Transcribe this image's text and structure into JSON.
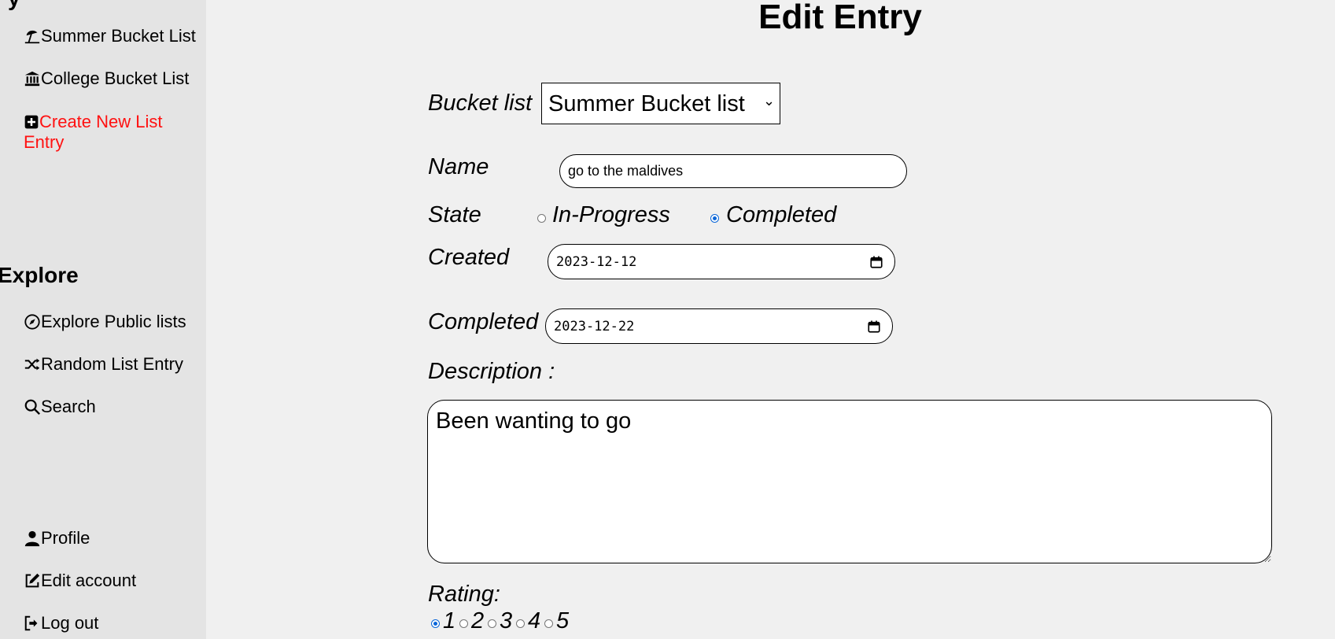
{
  "sidebar": {
    "items_top": [
      {
        "label": "Summer Bucket List",
        "icon": "umbrella-beach-icon"
      },
      {
        "label": "College Bucket List",
        "icon": "building-columns-icon"
      },
      {
        "label": "Create New List Entry",
        "icon": "plus-square-icon"
      }
    ],
    "explore_heading": "Explore",
    "items_explore": [
      {
        "label": "Explore Public lists",
        "icon": "compass-icon"
      },
      {
        "label": "Random List Entry",
        "icon": "shuffle-icon"
      },
      {
        "label": "Search",
        "icon": "search-icon"
      }
    ],
    "items_account": [
      {
        "label": "Profile",
        "icon": "user-icon"
      },
      {
        "label": "Edit account",
        "icon": "edit-icon"
      },
      {
        "label": "Log out",
        "icon": "logout-icon"
      }
    ]
  },
  "form": {
    "title": "Edit Entry",
    "bucket_list_label": "Bucket list",
    "bucket_list_value": "Summer Bucket list",
    "name_label": "Name",
    "name_value": "go to the maldives",
    "state_label": "State",
    "state_options": [
      "In-Progress",
      "Completed"
    ],
    "state_selected": "Completed",
    "created_label": "Created",
    "created_value": "2023-12-12",
    "completed_label": "Completed",
    "completed_value": "2023-12-22",
    "description_label": "Description :",
    "description_value": "Been wanting to go",
    "rating_label": "Rating:",
    "rating_options": [
      "1",
      "2",
      "3",
      "4",
      "5"
    ],
    "rating_selected": "1"
  },
  "colors": {
    "sidebar_bg": "#e4e4e4",
    "page_bg": "#f0f0f0",
    "accent_red": "#ff1111",
    "radio_blue": "#0a66d8"
  }
}
